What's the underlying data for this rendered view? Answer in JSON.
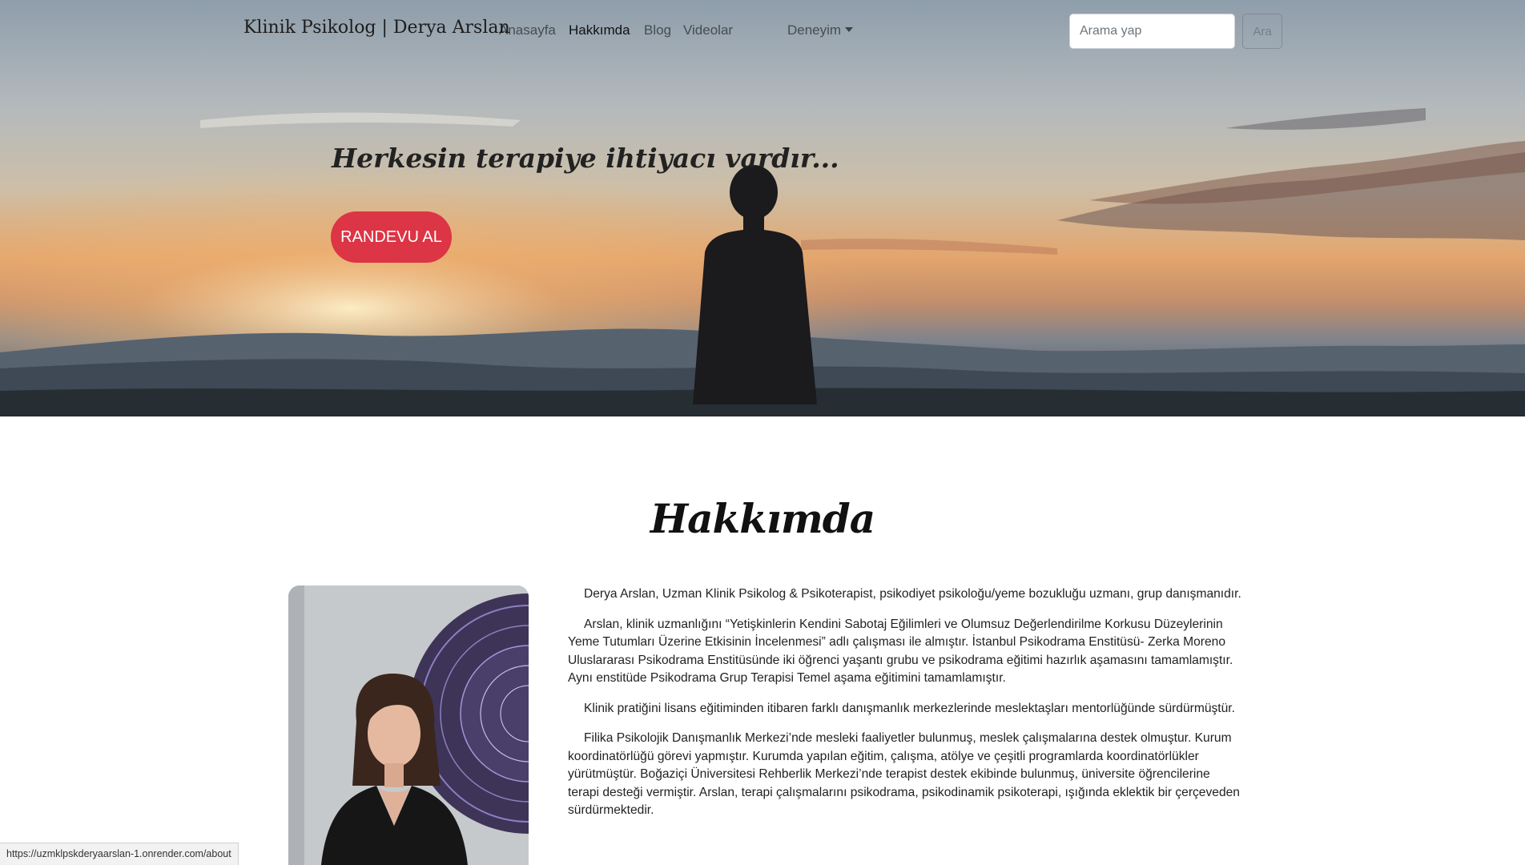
{
  "navbar": {
    "brand": "Klinik Psikolog | Derya Arslan",
    "links": [
      "Anasayfa",
      "Hakkımda",
      "Blog",
      "Videolar"
    ],
    "dropdown_label": "Deneyim",
    "search_placeholder": "Arama yap",
    "search_button": "Ara"
  },
  "hero": {
    "tagline": "Herkesin terapiye ihtiyacı vardır...",
    "cta_label": "RANDEVU AL"
  },
  "about": {
    "title": "Hakkımda",
    "paragraphs": [
      "Derya Arslan, Uzman Klinik Psikolog & Psikoterapist, psikodiyet psikoloğu/yeme bozukluğu uzmanı, grup danışmanıdır.",
      "Arslan, klinik uzmanlığını “Yetişkinlerin Kendini Sabotaj Eğilimleri ve Olumsuz Değerlendirilme Korkusu Düzeylerinin Yeme Tutumları Üzerine Etkisinin İncelenmesi” adlı çalışması ile almıştır. İstanbul Psikodrama Enstitüsü- Zerka Moreno Uluslararası Psikodrama Enstitüsünde iki öğrenci yaşantı grubu ve psikodrama eğitimi hazırlık aşamasını tamamlamıştır. Aynı enstitüde Psikodrama Grup Terapisi Temel aşama eğitimini tamamlamıştır.",
      "Klinik pratiğini lisans eğitiminden itibaren farklı danışmanlık merkezlerinde meslektaşları mentorlüğünde sürdürmüştür.",
      "Filika Psikolojik Danışmanlık Merkezi’nde mesleki faaliyetler bulunmuş, meslek çalışmalarına destek olmuştur. Kurum koordinatörlüğü görevi yapmıştır. Kurumda yapılan eğitim, çalışma, atölye ve çeşitli programlarda koordinatörlükler yürütmüştür. Boğaziçi Üniversitesi Rehberlik Merkezi’nde terapist destek ekibinde bulunmuş, üniversite öğrencilerine terapi desteği vermiştir. Arslan, terapi çalışmalarını psikodrama, psikodinamik psikoterapi, ışığında eklektik bir çerçeveden sürdürmektedir."
    ]
  },
  "status_bar": {
    "url": "https://uzmklpskderyaarslan-1.onrender.com/about"
  },
  "colors": {
    "accent": "#dc3545"
  }
}
